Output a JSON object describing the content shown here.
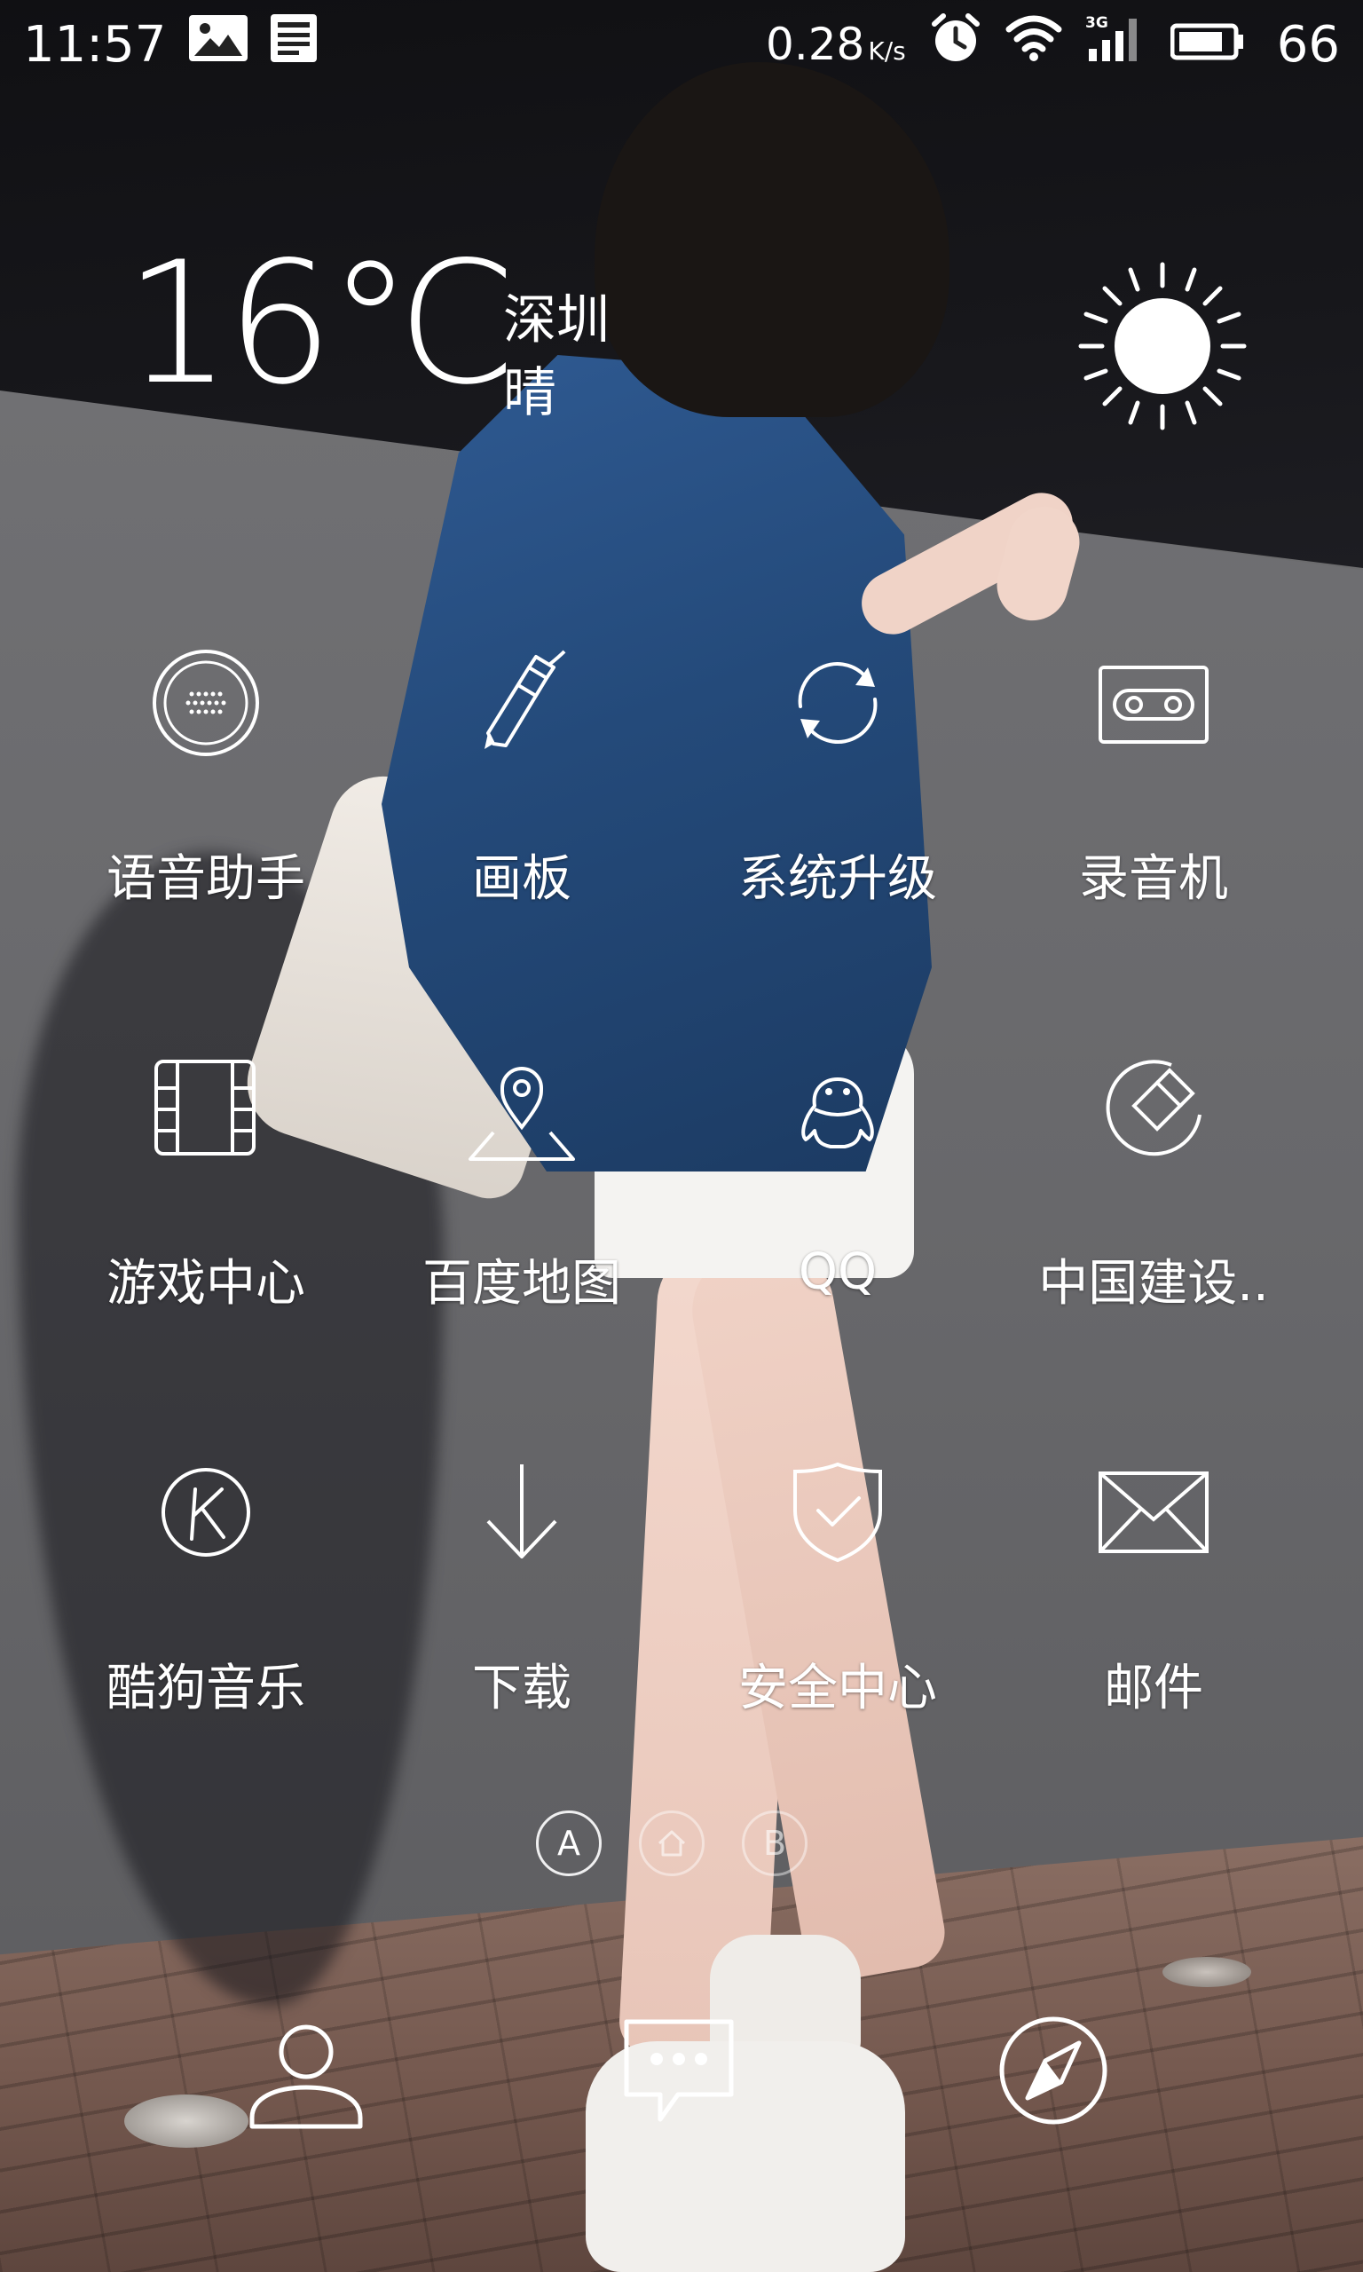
{
  "status_bar": {
    "time": "11:57",
    "network_speed_value": "0.28",
    "network_speed_unit": "K/s",
    "network_type": "3G",
    "battery": "66",
    "left_icons": [
      "gallery-icon",
      "news-icon"
    ],
    "right_icons": [
      "alarm-icon",
      "wifi-icon",
      "signal-3g-icon",
      "battery-icon"
    ]
  },
  "weather": {
    "temperature": "16℃",
    "city": "深圳",
    "condition": "晴",
    "icon": "sun-icon"
  },
  "apps": [
    {
      "label": "语音助手",
      "icon": "voice-assistant-icon"
    },
    {
      "label": "画板",
      "icon": "pencil-icon"
    },
    {
      "label": "系统升级",
      "icon": "refresh-icon"
    },
    {
      "label": "录音机",
      "icon": "cassette-icon"
    },
    {
      "label": "游戏中心",
      "icon": "game-board-icon"
    },
    {
      "label": "百度地图",
      "icon": "map-pin-icon"
    },
    {
      "label": "QQ",
      "icon": "penguin-icon"
    },
    {
      "label": "中国建设..",
      "icon": "ccb-bank-icon"
    },
    {
      "label": "酷狗音乐",
      "icon": "kugou-k-icon"
    },
    {
      "label": "下载",
      "icon": "download-arrow-icon"
    },
    {
      "label": "安全中心",
      "icon": "shield-check-icon"
    },
    {
      "label": "邮件",
      "icon": "envelope-icon"
    }
  ],
  "page_indicator": {
    "pages": [
      "A",
      "home",
      "B"
    ],
    "active": "A"
  },
  "dock": [
    {
      "icon": "contacts-icon"
    },
    {
      "icon": "messages-icon"
    },
    {
      "icon": "browser-compass-icon"
    }
  ]
}
